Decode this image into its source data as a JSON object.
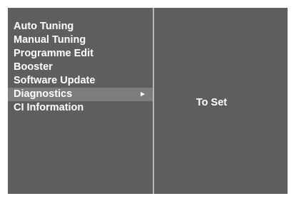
{
  "menu": {
    "items": [
      {
        "label": "Auto Tuning"
      },
      {
        "label": "Manual Tuning"
      },
      {
        "label": "Programme Edit"
      },
      {
        "label": "Booster"
      },
      {
        "label": "Software Update"
      },
      {
        "label": "Diagnostics",
        "selected": true
      },
      {
        "label": "CI Information"
      }
    ],
    "selected_arrow": "►"
  },
  "right_panel": {
    "action_text": "To Set"
  },
  "colors": {
    "panel_bg": "#5e5e5e",
    "highlight_bg": "#7d7d7d",
    "divider": "#b9b9b9",
    "text": "#ffffff"
  }
}
